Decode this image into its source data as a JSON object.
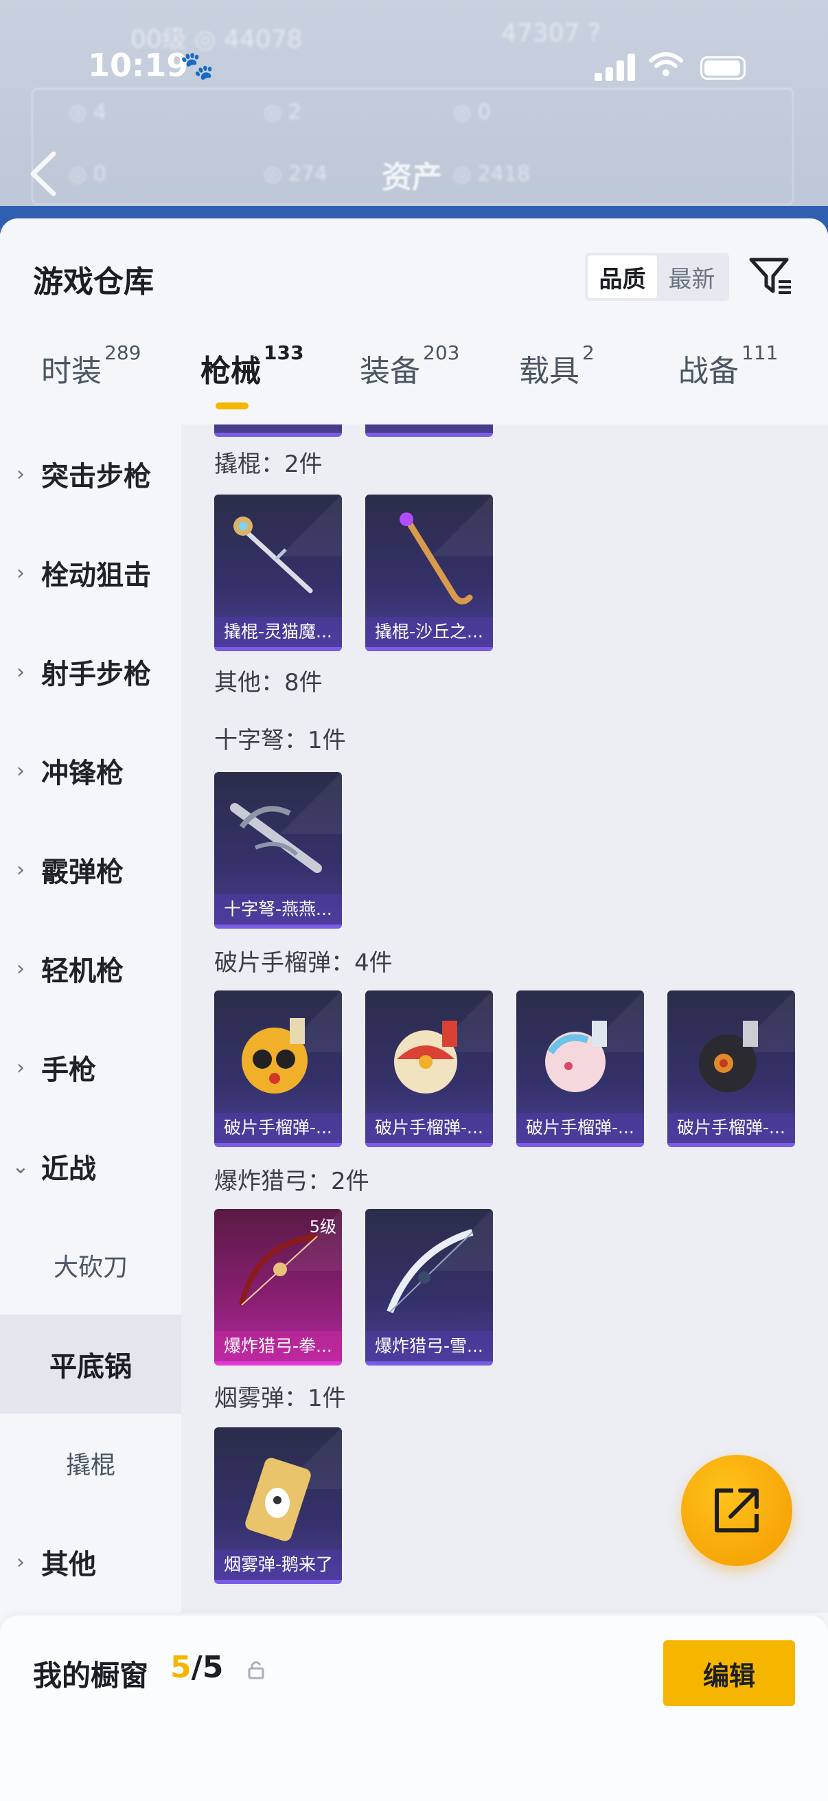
{
  "status_bar": {
    "time": "10:19"
  },
  "header": {
    "title": "资产"
  },
  "sheet": {
    "title": "游戏仓库",
    "sort_options": [
      "品质",
      "最新"
    ],
    "sort_selected": "品质"
  },
  "tabs": [
    {
      "label": "时装",
      "count": "289"
    },
    {
      "label": "枪械",
      "count": "133"
    },
    {
      "label": "装备",
      "count": "203"
    },
    {
      "label": "载具",
      "count": "2"
    },
    {
      "label": "战备",
      "count": "111"
    }
  ],
  "sidebar": {
    "items": [
      {
        "label": "突击步枪"
      },
      {
        "label": "栓动狙击"
      },
      {
        "label": "射手步枪"
      },
      {
        "label": "冲锋枪"
      },
      {
        "label": "霰弹枪"
      },
      {
        "label": "轻机枪"
      },
      {
        "label": "手枪"
      },
      {
        "label": "近战"
      },
      {
        "label": "大砍刀"
      },
      {
        "label": "平底锅"
      },
      {
        "label": "撬棍"
      },
      {
        "label": "其他"
      }
    ]
  },
  "content": {
    "sections": [
      {
        "title": "撬棍：2件",
        "items": [
          {
            "name": "撬棍-灵猫魔..."
          },
          {
            "name": "撬棍-沙丘之..."
          }
        ]
      },
      {
        "title": "其他：8件",
        "items": []
      },
      {
        "title": "十字弩：1件",
        "items": [
          {
            "name": "十字弩-燕燕..."
          }
        ]
      },
      {
        "title": "破片手榴弹：4件",
        "items": [
          {
            "name": "破片手榴弹-..."
          },
          {
            "name": "破片手榴弹-..."
          },
          {
            "name": "破片手榴弹-..."
          },
          {
            "name": "破片手榴弹-..."
          }
        ]
      },
      {
        "title": "爆炸猎弓：2件",
        "items": [
          {
            "name": "爆炸猎弓-拳...",
            "level": "5级"
          },
          {
            "name": "爆炸猎弓-雪..."
          }
        ]
      },
      {
        "title": "烟雾弹：1件",
        "items": [
          {
            "name": "烟雾弹-鹅来了"
          }
        ]
      }
    ]
  },
  "bottom_bar": {
    "title": "我的橱窗",
    "count_current": "5",
    "count_total": "/5",
    "edit_label": "编辑"
  },
  "colors": {
    "accent": "#f6b600",
    "card_purple": "#4a3c8e",
    "card_pink": "#b02aa0"
  }
}
